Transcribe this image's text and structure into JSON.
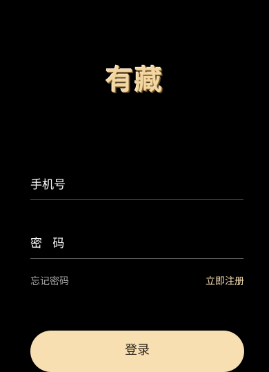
{
  "app": {
    "logo_text": "有藏"
  },
  "form": {
    "phone_placeholder": "手机号",
    "phone_value": "",
    "password_placeholder": "密 码",
    "password_value": "",
    "forgot_label": "忘记密码",
    "register_label": "立即注册",
    "login_label": "登录"
  },
  "colors": {
    "background": "#000000",
    "accent": "#f7dfb2",
    "divider": "#5c5c5c",
    "muted_text": "#a8a8a8"
  }
}
